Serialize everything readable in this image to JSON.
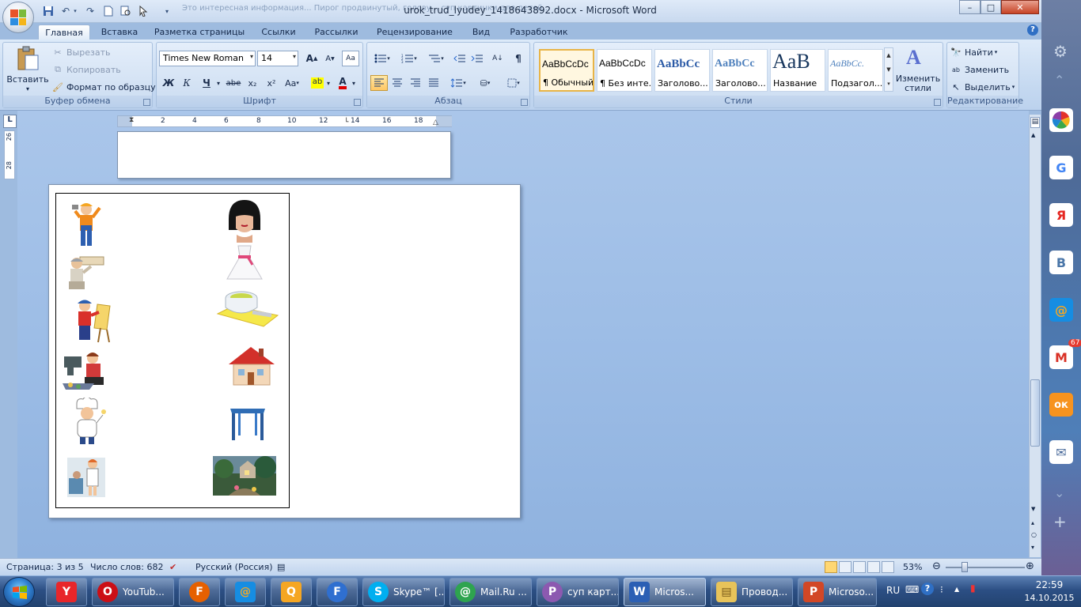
{
  "titlebar": {
    "title": "urok_trud_lyudey_1418643892.docx - Microsoft Word",
    "ghost_text": "Это интересная информация...   Пирог продвинутый, голову...   суп картинки для детей..."
  },
  "quick_access": {
    "icons": [
      "save-icon",
      "undo-icon",
      "redo-icon",
      "new-doc-icon",
      "print-preview-icon",
      "select-icon",
      "qat-more-icon"
    ]
  },
  "window_controls": {
    "minimize": "–",
    "maximize": "□",
    "close": "✕"
  },
  "ribbon_tabs": [
    "Главная",
    "Вставка",
    "Разметка страницы",
    "Ссылки",
    "Рассылки",
    "Рецензирование",
    "Вид",
    "Разработчик"
  ],
  "active_tab": "Главная",
  "clipboard": {
    "paste": "Вставить",
    "cut": "Вырезать",
    "copy": "Копировать",
    "format_painter": "Формат по образцу",
    "label": "Буфер обмена"
  },
  "font": {
    "family": "Times New Roman",
    "size": "14",
    "label": "Шрифт",
    "bold": "Ж",
    "italic": "К",
    "underline": "Ч",
    "strike": "abe",
    "subscript": "x₂",
    "superscript": "x²",
    "change_case": "Aa",
    "grow": "A",
    "shrink": "A",
    "highlight_color": "#ffff00",
    "font_color": "#e00000"
  },
  "paragraph": {
    "label": "Абзац",
    "pilcrow": "¶"
  },
  "styles": {
    "label": "Стили",
    "items": [
      {
        "sample": "AaBbCcDc",
        "name": "¶ Обычный",
        "selected": true
      },
      {
        "sample": "AaBbCcDc",
        "name": "¶ Без инте...",
        "selected": false
      },
      {
        "sample": "AaBbCc",
        "name": "Заголово...",
        "selected": false
      },
      {
        "sample": "AaBbCc",
        "name": "Заголово...",
        "selected": false
      },
      {
        "sample": "AaB",
        "name": "Название",
        "selected": false
      },
      {
        "sample": "AaBbCc.",
        "name": "Подзагол...",
        "selected": false
      }
    ],
    "change_styles": "Изменить стили"
  },
  "editing": {
    "label": "Редактирование",
    "find": "Найти",
    "replace": "Заменить",
    "select": "Выделить"
  },
  "ruler": {
    "corner": "L",
    "marks": [
      "2",
      "4",
      "6",
      "8",
      "10",
      "12",
      "14",
      "16",
      "18"
    ],
    "vmarks": [
      "26",
      "28"
    ]
  },
  "document": {
    "left_column": [
      "worker-illustration",
      "plasterer-illustration",
      "painter-illustration",
      "seamstress-illustration",
      "chef-illustration",
      "doctor-illustration"
    ],
    "right_column": [
      "hairstyle-photo",
      "dress-illustration",
      "soup-illustration",
      "house-illustration",
      "table-illustration",
      "landscape-painting"
    ]
  },
  "statusbar": {
    "page": "Страница: 3 из 5",
    "words": "Число слов: 682",
    "language": "Русский (Россия)",
    "zoom": "53%",
    "zoom_level": 0.53
  },
  "sidebar": {
    "items": [
      {
        "name": "settings-icon",
        "label": ""
      },
      {
        "name": "up-chevron-icon",
        "label": ""
      },
      {
        "name": "picasa-icon",
        "label": ""
      },
      {
        "name": "google-icon",
        "label": "G"
      },
      {
        "name": "yandex-icon",
        "label": "Я"
      },
      {
        "name": "vk-icon",
        "label": "В"
      },
      {
        "name": "mail-at-icon",
        "label": "@"
      },
      {
        "name": "gmail-icon",
        "label": "M",
        "badge": "67"
      },
      {
        "name": "odnoklassniki-icon",
        "label": "ок"
      },
      {
        "name": "mail-envelope-icon",
        "label": "✉"
      },
      {
        "name": "down-chevron-icon",
        "label": ""
      },
      {
        "name": "add-icon",
        "label": "+"
      }
    ]
  },
  "taskbar": {
    "buttons": [
      {
        "name": "yandex-browser-button",
        "label": "",
        "icon_color": "#e8262a",
        "glyph": "Y"
      },
      {
        "name": "opera-youtube-button",
        "label": "YouTub...",
        "icon_color": "#cc0f16",
        "glyph": "O"
      },
      {
        "name": "firefox-button",
        "label": "",
        "icon_color": "#e66000",
        "glyph": "F"
      },
      {
        "name": "mail-agent-button",
        "label": "",
        "icon_color": "#168de2",
        "glyph": "@"
      },
      {
        "name": "search-app-button",
        "label": "",
        "icon_color": "#f5a623",
        "glyph": "Q"
      },
      {
        "name": "firefox2-button",
        "label": "",
        "icon_color": "#2f6fd0",
        "glyph": "F"
      },
      {
        "name": "skype-button",
        "label": "Skype™ [...",
        "icon_color": "#00aff0",
        "glyph": "S"
      },
      {
        "name": "mailru-button",
        "label": "Mail.Ru ...",
        "icon_color": "#2ea44f",
        "glyph": "@"
      },
      {
        "name": "picasa-button",
        "label": "суп карт...",
        "icon_color": "#8c59b0",
        "glyph": "P"
      },
      {
        "name": "word-button",
        "label": "Micros...",
        "icon_color": "#2b5fb4",
        "glyph": "W"
      },
      {
        "name": "explorer-button",
        "label": "Провод...",
        "icon_color": "#e7c35a",
        "glyph": "▤"
      },
      {
        "name": "powerpoint-button",
        "label": "Microso...",
        "icon_color": "#d24726",
        "glyph": "P"
      }
    ],
    "tray": {
      "lang": "RU",
      "time": "22:59",
      "date": "14.10.2015"
    }
  }
}
